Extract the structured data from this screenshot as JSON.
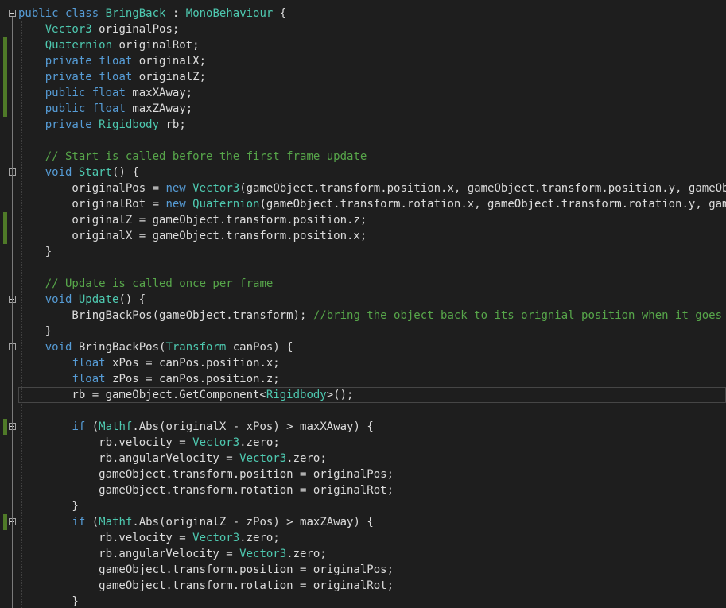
{
  "editor": {
    "lines": [
      {
        "tokens": [
          [
            "kw",
            "public"
          ],
          [
            "txt",
            " "
          ],
          [
            "kw",
            "class"
          ],
          [
            "txt",
            " "
          ],
          [
            "type",
            "BringBack"
          ],
          [
            "txt",
            " : "
          ],
          [
            "type",
            "MonoBehaviour"
          ],
          [
            "txt",
            " {"
          ]
        ]
      },
      {
        "tokens": [
          [
            "txt",
            "    "
          ],
          [
            "type",
            "Vector3"
          ],
          [
            "txt",
            " originalPos;"
          ]
        ]
      },
      {
        "tokens": [
          [
            "txt",
            "    "
          ],
          [
            "type",
            "Quaternion"
          ],
          [
            "txt",
            " originalRot;"
          ]
        ]
      },
      {
        "tokens": [
          [
            "txt",
            "    "
          ],
          [
            "kw",
            "private"
          ],
          [
            "txt",
            " "
          ],
          [
            "kw",
            "float"
          ],
          [
            "txt",
            " originalX;"
          ]
        ]
      },
      {
        "tokens": [
          [
            "txt",
            "    "
          ],
          [
            "kw",
            "private"
          ],
          [
            "txt",
            " "
          ],
          [
            "kw",
            "float"
          ],
          [
            "txt",
            " originalZ;"
          ]
        ]
      },
      {
        "tokens": [
          [
            "txt",
            "    "
          ],
          [
            "kw",
            "public"
          ],
          [
            "txt",
            " "
          ],
          [
            "kw",
            "float"
          ],
          [
            "txt",
            " maxXAway;"
          ]
        ]
      },
      {
        "tokens": [
          [
            "txt",
            "    "
          ],
          [
            "kw",
            "public"
          ],
          [
            "txt",
            " "
          ],
          [
            "kw",
            "float"
          ],
          [
            "txt",
            " maxZAway;"
          ]
        ]
      },
      {
        "tokens": [
          [
            "txt",
            "    "
          ],
          [
            "kw",
            "private"
          ],
          [
            "txt",
            " "
          ],
          [
            "type",
            "Rigidbody"
          ],
          [
            "txt",
            " rb;"
          ]
        ]
      },
      {
        "tokens": []
      },
      {
        "tokens": [
          [
            "txt",
            "    "
          ],
          [
            "cm",
            "// Start is called before the first frame update"
          ]
        ]
      },
      {
        "tokens": [
          [
            "txt",
            "    "
          ],
          [
            "kw",
            "void"
          ],
          [
            "txt",
            " "
          ],
          [
            "type",
            "Start"
          ],
          [
            "txt",
            "() {"
          ]
        ]
      },
      {
        "tokens": [
          [
            "txt",
            "        originalPos = "
          ],
          [
            "kw",
            "new"
          ],
          [
            "txt",
            " "
          ],
          [
            "type",
            "Vector3"
          ],
          [
            "txt",
            "(gameObject.transform.position.x, gameObject.transform.position.y, gameObject.transform.position.z);"
          ]
        ]
      },
      {
        "tokens": [
          [
            "txt",
            "        originalRot = "
          ],
          [
            "kw",
            "new"
          ],
          [
            "txt",
            " "
          ],
          [
            "type",
            "Quaternion"
          ],
          [
            "txt",
            "(gameObject.transform.rotation.x, gameObject.transform.rotation.y, gameObject.transform.rotation.z, gameObject.transform.rotation.w);"
          ]
        ]
      },
      {
        "tokens": [
          [
            "txt",
            "        originalZ = gameObject.transform.position.z;"
          ]
        ]
      },
      {
        "tokens": [
          [
            "txt",
            "        originalX = gameObject.transform.position.x;"
          ]
        ]
      },
      {
        "tokens": [
          [
            "txt",
            "    }"
          ]
        ]
      },
      {
        "tokens": []
      },
      {
        "tokens": [
          [
            "txt",
            "    "
          ],
          [
            "cm",
            "// Update is called once per frame"
          ]
        ]
      },
      {
        "tokens": [
          [
            "txt",
            "    "
          ],
          [
            "kw",
            "void"
          ],
          [
            "txt",
            " "
          ],
          [
            "type",
            "Update"
          ],
          [
            "txt",
            "() {"
          ]
        ]
      },
      {
        "tokens": [
          [
            "txt",
            "        BringBackPos(gameObject.transform); "
          ],
          [
            "cm",
            "//bring the object back to its orignial position when it goes too far"
          ]
        ]
      },
      {
        "tokens": [
          [
            "txt",
            "    }"
          ]
        ]
      },
      {
        "tokens": [
          [
            "txt",
            "    "
          ],
          [
            "kw",
            "void"
          ],
          [
            "txt",
            " BringBackPos("
          ],
          [
            "type",
            "Transform"
          ],
          [
            "txt",
            " canPos) {"
          ]
        ]
      },
      {
        "tokens": [
          [
            "txt",
            "        "
          ],
          [
            "kw",
            "float"
          ],
          [
            "txt",
            " xPos = canPos.position.x;"
          ]
        ]
      },
      {
        "tokens": [
          [
            "txt",
            "        "
          ],
          [
            "kw",
            "float"
          ],
          [
            "txt",
            " zPos = canPos.position.z;"
          ]
        ]
      },
      {
        "tokens": [
          [
            "txt",
            "        rb = gameObject.GetComponent<"
          ],
          [
            "type",
            "Rigidbody"
          ],
          [
            "txt",
            ">();"
          ]
        ]
      },
      {
        "tokens": []
      },
      {
        "tokens": [
          [
            "txt",
            "        "
          ],
          [
            "kw",
            "if"
          ],
          [
            "txt",
            " ("
          ],
          [
            "type",
            "Mathf"
          ],
          [
            "txt",
            ".Abs(originalX - xPos) > maxXAway) {"
          ]
        ]
      },
      {
        "tokens": [
          [
            "txt",
            "            rb.velocity = "
          ],
          [
            "type",
            "Vector3"
          ],
          [
            "txt",
            ".zero;"
          ]
        ]
      },
      {
        "tokens": [
          [
            "txt",
            "            rb.angularVelocity = "
          ],
          [
            "type",
            "Vector3"
          ],
          [
            "txt",
            ".zero;"
          ]
        ]
      },
      {
        "tokens": [
          [
            "txt",
            "            gameObject.transform.position = originalPos;"
          ]
        ]
      },
      {
        "tokens": [
          [
            "txt",
            "            gameObject.transform.rotation = originalRot;"
          ]
        ]
      },
      {
        "tokens": [
          [
            "txt",
            "        }"
          ]
        ]
      },
      {
        "tokens": [
          [
            "txt",
            "        "
          ],
          [
            "kw",
            "if"
          ],
          [
            "txt",
            " ("
          ],
          [
            "type",
            "Mathf"
          ],
          [
            "txt",
            ".Abs(originalZ - zPos) > maxZAway) {"
          ]
        ]
      },
      {
        "tokens": [
          [
            "txt",
            "            rb.velocity = "
          ],
          [
            "type",
            "Vector3"
          ],
          [
            "txt",
            ".zero;"
          ]
        ]
      },
      {
        "tokens": [
          [
            "txt",
            "            rb.angularVelocity = "
          ],
          [
            "type",
            "Vector3"
          ],
          [
            "txt",
            ".zero;"
          ]
        ]
      },
      {
        "tokens": [
          [
            "txt",
            "            gameObject.transform.position = originalPos;"
          ]
        ]
      },
      {
        "tokens": [
          [
            "txt",
            "            gameObject.transform.rotation = originalRot;"
          ]
        ]
      },
      {
        "tokens": [
          [
            "txt",
            "        }"
          ]
        ]
      }
    ],
    "colors": {
      "background": "#1e1e1e",
      "keyword": "#569cd6",
      "type": "#4ec9b0",
      "comment": "#57a64a",
      "text": "#dcdcdc",
      "modified_marker": "#4f7a28"
    }
  }
}
